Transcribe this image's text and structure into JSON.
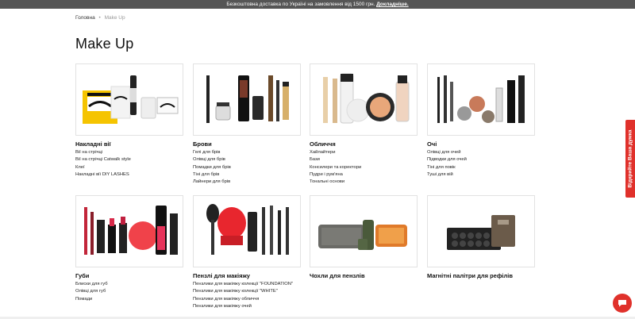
{
  "topbar": {
    "text": "Безкоштовна доставка по Україні на замовлення від 1500 грн.",
    "link": "Докладніше."
  },
  "breadcrumb": {
    "home": "Головна",
    "separator": "•",
    "current": "Make Up"
  },
  "page_title": "Make Up",
  "categories": [
    {
      "name": "Накладні вії",
      "items": [
        "Вії на стрічці",
        "Вії на стрічці Catwalk style",
        "Клеї",
        "Накладні вії DIY LASHES"
      ]
    },
    {
      "name": "Брови",
      "items": [
        "Гелі для брів",
        "Олівці для брів",
        "Помадки для брів",
        "Тіні для брів",
        "Лайнери для брів"
      ]
    },
    {
      "name": "Обличчя",
      "items": [
        "Хайлайтери",
        "Бази",
        "Консилери та коректори",
        "Пудри і рум'яна",
        "Тональні основи"
      ]
    },
    {
      "name": "Очі",
      "items": [
        "Олівці для очей",
        "Підводки для очей",
        "Тіні для повік",
        "Туші для вій"
      ]
    },
    {
      "name": "Губи",
      "items": [
        "Блиски для губ",
        "Олівці для губ",
        "Помади"
      ]
    },
    {
      "name": "Пензлі для макіяжу",
      "items": [
        "Пензлики для макіяжу колекції \"FOUNDATION\"",
        "Пензлики для макіяжу колекції \"WHITE\"",
        "Пензлики для макіяжу обличчя",
        "Пензлики для макіяжу очей"
      ]
    },
    {
      "name": "Чохли для пензлів",
      "items": []
    },
    {
      "name": "Магнітні палітри для рефілів",
      "items": []
    }
  ],
  "side_tab": "Відкрийте Ваша думка",
  "icons": {
    "side_tab": "gift-icon",
    "chat": "chat-icon"
  },
  "colors": {
    "accent": "#e0312b",
    "topbar": "#555555"
  }
}
